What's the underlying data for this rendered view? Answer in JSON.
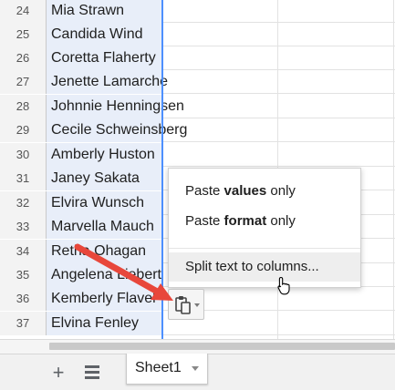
{
  "rows": [
    {
      "number": "24",
      "name": "Mia Strawn"
    },
    {
      "number": "25",
      "name": "Candida Wind"
    },
    {
      "number": "26",
      "name": "Coretta Flaherty"
    },
    {
      "number": "27",
      "name": "Jenette Lamarche"
    },
    {
      "number": "28",
      "name": "Johnnie Henningsen"
    },
    {
      "number": "29",
      "name": "Cecile Schweinsberg"
    },
    {
      "number": "30",
      "name": "Amberly Huston"
    },
    {
      "number": "31",
      "name": "Janey Sakata"
    },
    {
      "number": "32",
      "name": "Elvira Wunsch"
    },
    {
      "number": "33",
      "name": "Marvella Mauch"
    },
    {
      "number": "34",
      "name": "Retha Ohagan"
    },
    {
      "number": "35",
      "name": "Angelena Liebert"
    },
    {
      "number": "36",
      "name": "Kemberly Flavel"
    },
    {
      "number": "37",
      "name": "Elvina Fenley"
    }
  ],
  "context_menu": {
    "paste_values": {
      "prefix": "Paste ",
      "bold": "values",
      "suffix": " only"
    },
    "paste_format": {
      "prefix": "Paste ",
      "bold": "format",
      "suffix": " only"
    },
    "split_text": "Split text to columns..."
  },
  "sheet_bar": {
    "add_icon": "plus-icon",
    "list_icon": "all-sheets-list-icon",
    "active_tab": "Sheet1"
  },
  "colors": {
    "selection_border": "#4d90fe",
    "selected_column_fill": "#e8eef9",
    "annotation_arrow": "#e8473b"
  },
  "icons": {
    "paste_options": "clipboard-icon",
    "cursor": "hand-pointer-icon",
    "annotation": "red-arrow-icon"
  }
}
